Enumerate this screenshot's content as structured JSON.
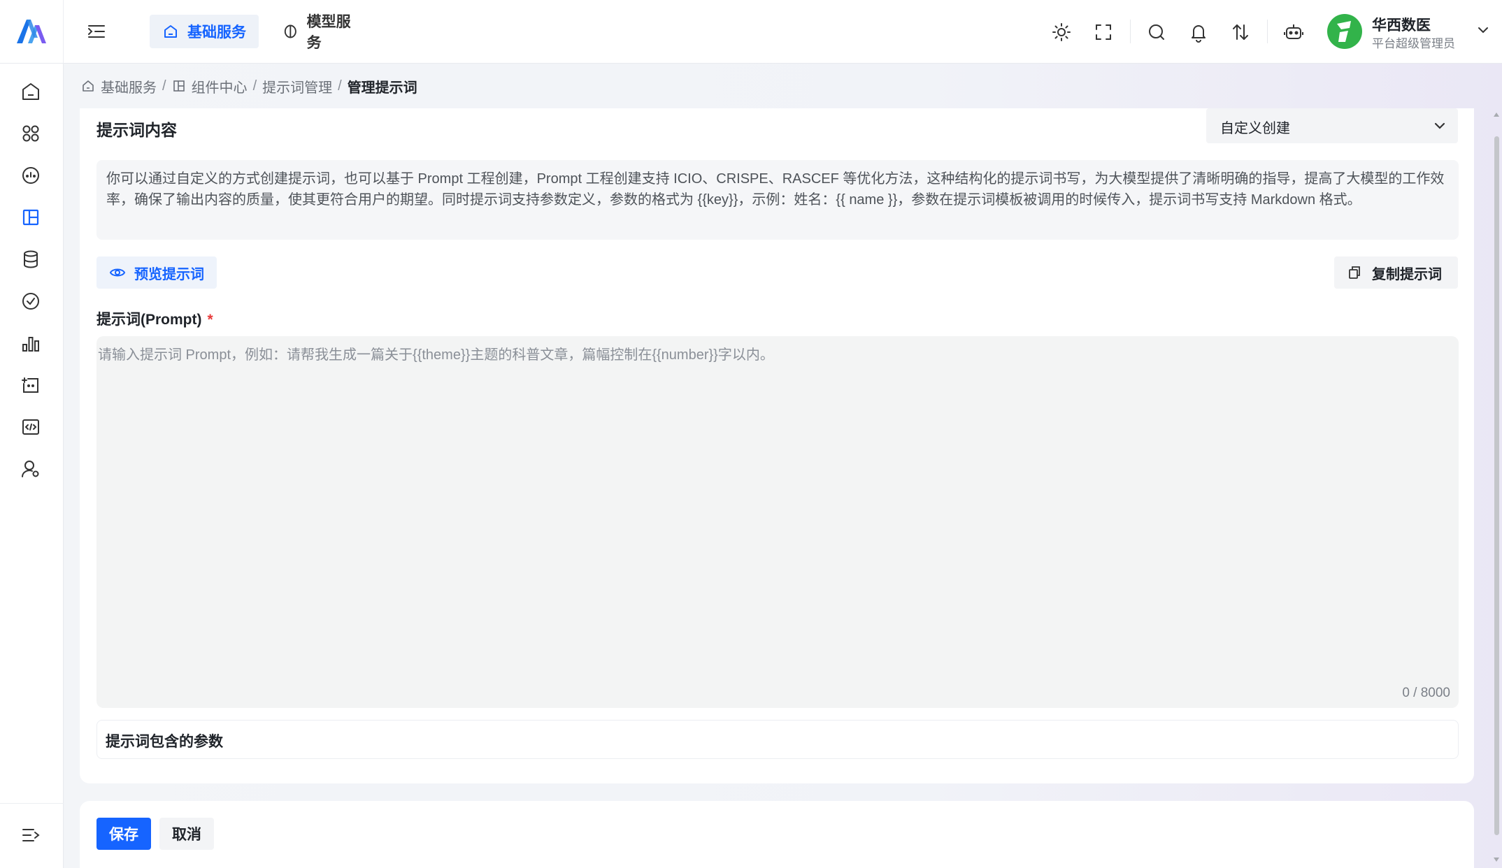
{
  "header": {
    "tabs": [
      {
        "label": "基础服务",
        "active": true
      },
      {
        "label": "模型服务",
        "active": false
      }
    ],
    "icons": [
      "menu-collapse-icon",
      "sun-icon",
      "fullscreen-icon",
      "search-icon",
      "bell-icon",
      "swap-icon",
      "robot-icon"
    ],
    "user": {
      "name": "华西数医",
      "role": "平台超级管理员"
    }
  },
  "sidebar": {
    "items": [
      "home-icon",
      "apps-icon",
      "dashboard-icon",
      "layout-icon",
      "database-icon",
      "check-circle-icon",
      "bar-chart-icon",
      "import-icon",
      "code-icon",
      "user-settings-icon"
    ],
    "bottom": "expand-icon"
  },
  "breadcrumb": {
    "items": [
      "基础服务",
      "组件中心",
      "提示词管理"
    ],
    "current": "管理提示词",
    "separator": "/"
  },
  "content": {
    "section_title": "提示词内容",
    "mode_select": "自定义创建",
    "description": "你可以通过自定义的方式创建提示词，也可以基于 Prompt 工程创建，Prompt 工程创建支持 ICIO、CRISPE、RASCEF 等优化方法，这种结构化的提示词书写，为大模型提供了清晰明确的指导，提高了大模型的工作效率，确保了输出内容的质量，使其更符合用户的期望。同时提示词支持参数定义，参数的格式为 {{key}}，示例：姓名：{{ name }}，参数在提示词模板被调用的时候传入，提示词书写支持 Markdown 格式。",
    "preview_button": "预览提示词",
    "copy_button": "复制提示词",
    "prompt_label": "提示词(Prompt)",
    "required_mark": "*",
    "prompt_value": "",
    "prompt_placeholder": "请输入提示词 Prompt，例如：请帮我生成一篇关于{{theme}}主题的科普文章，篇幅控制在{{number}}字以内。",
    "counter": "0 / 8000",
    "params_title": "提示词包含的参数"
  },
  "footer": {
    "save": "保存",
    "cancel": "取消"
  },
  "colors": {
    "accent": "#1664ff",
    "required": "#e83b3b",
    "avatar": "#32b34a"
  }
}
